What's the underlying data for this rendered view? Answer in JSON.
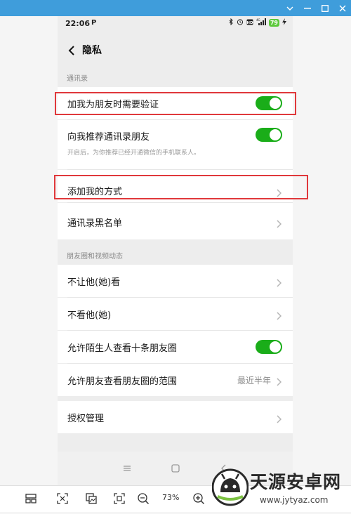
{
  "status_bar": {
    "time": "22:06",
    "p_icon": "P",
    "battery": "79",
    "icons": [
      "bluetooth-icon",
      "alarm-icon",
      "hd-icon",
      "signal-icon",
      "battery-icon",
      "charging-icon"
    ]
  },
  "header": {
    "title": "隐私"
  },
  "sections": [
    {
      "label": "通讯录",
      "items": [
        {
          "title": "加我为朋友时需要验证",
          "toggle": true
        },
        {
          "title": "向我推荐通讯录朋友",
          "subtitle": "开启后，为你推荐已经开通微信的手机联系人。",
          "toggle": true
        },
        {
          "title": "添加我的方式",
          "chevron": true
        },
        {
          "title": "通讯录黑名单",
          "chevron": true
        }
      ]
    },
    {
      "label": "朋友圈和视频动态",
      "items": [
        {
          "title": "不让他(她)看",
          "chevron": true
        },
        {
          "title": "不看他(她)",
          "chevron": true
        },
        {
          "title": "允许陌生人查看十条朋友圈",
          "toggle": true
        },
        {
          "title": "允许朋友查看朋友圈的范围",
          "value": "最近半年",
          "chevron": true
        }
      ]
    },
    {
      "label": "",
      "items": [
        {
          "title": "授权管理",
          "chevron": true
        }
      ]
    }
  ],
  "toolbar": {
    "zoom": "73%"
  },
  "watermark": {
    "name": "天源安卓网",
    "url": "www.jytyaz.com"
  },
  "colors": {
    "toggle_on": "#1aad19",
    "highlight": "#e0383b",
    "titlebar": "#3f9ddb"
  }
}
